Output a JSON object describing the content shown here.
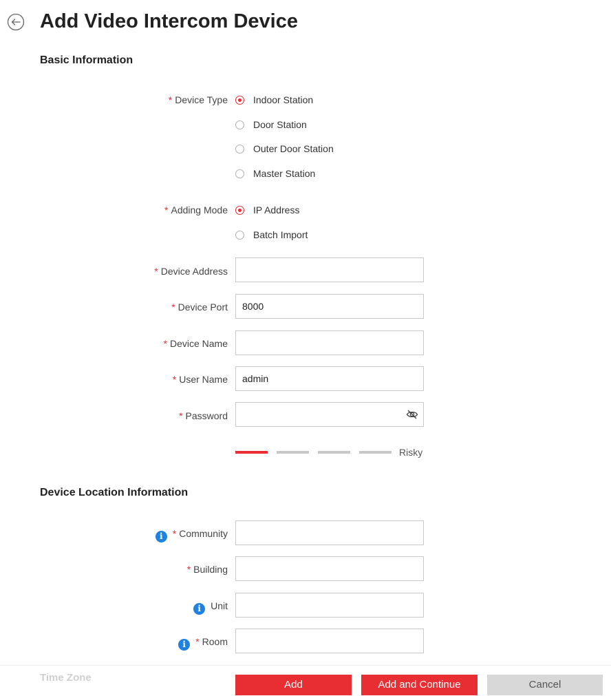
{
  "page": {
    "title": "Add Video Intercom Device"
  },
  "basic_info": {
    "section_title": "Basic Information",
    "device_type": {
      "label": "Device Type",
      "options": [
        "Indoor Station",
        "Door Station",
        "Outer Door Station",
        "Master Station"
      ],
      "selected": "Indoor Station"
    },
    "adding_mode": {
      "label": "Adding Mode",
      "options": [
        "IP Address",
        "Batch Import"
      ],
      "selected": "IP Address"
    },
    "device_address": {
      "label": "Device Address",
      "value": ""
    },
    "device_port": {
      "label": "Device Port",
      "value": "8000"
    },
    "device_name": {
      "label": "Device Name",
      "value": ""
    },
    "user_name": {
      "label": "User Name",
      "value": "admin"
    },
    "password": {
      "label": "Password",
      "value": ""
    },
    "password_strength": {
      "text": "Risky",
      "level": 1,
      "levels_total": 4
    },
    "required_marker": "*"
  },
  "location_info": {
    "section_title": "Device Location Information",
    "community": {
      "label": "Community",
      "value": ""
    },
    "building": {
      "label": "Building",
      "value": ""
    },
    "unit": {
      "label": "Unit",
      "value": ""
    },
    "room": {
      "label": "Room",
      "value": ""
    },
    "info_glyph": "i"
  },
  "footer": {
    "time_zone_label": "Time Zone",
    "add_label": "Add",
    "add_continue_label": "Add and Continue",
    "cancel_label": "Cancel"
  },
  "colors": {
    "accent": "#e82d33",
    "info": "#1e82e0",
    "inactive_bar": "#c8c8c8"
  },
  "icons": {
    "back": "back-arrow-circle-icon",
    "password_visibility": "eye-hidden-icon",
    "info": "info-icon"
  }
}
